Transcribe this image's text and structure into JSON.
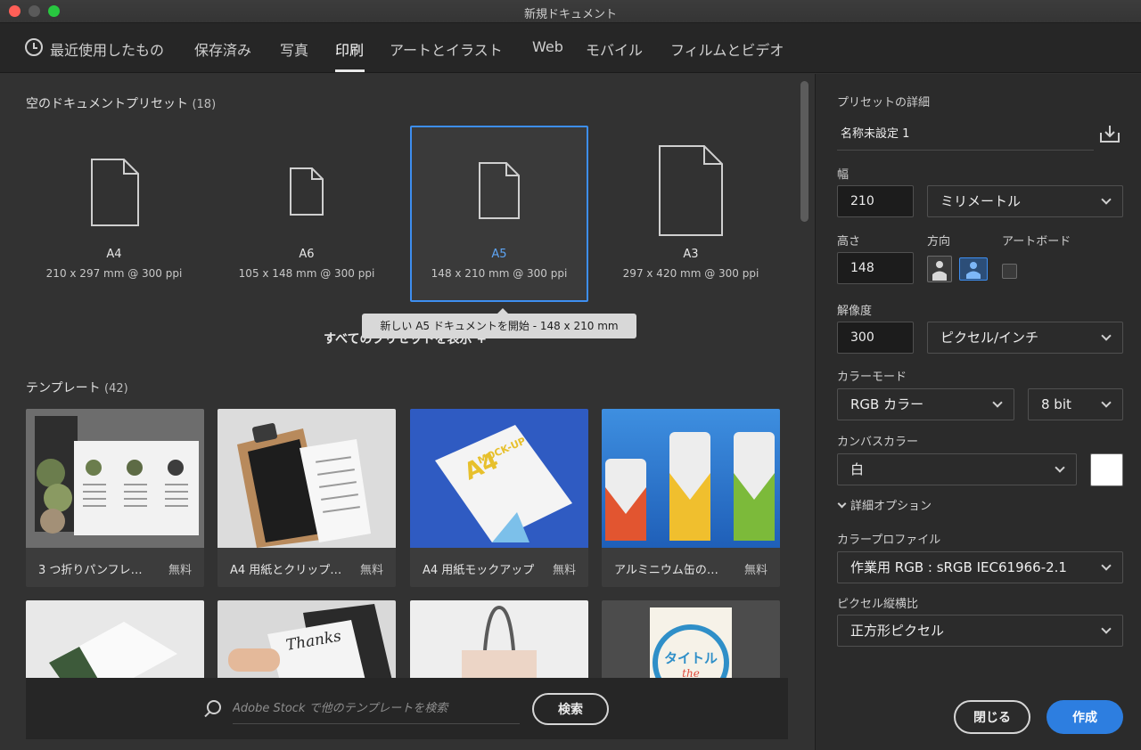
{
  "window": {
    "title": "新規ドキュメント"
  },
  "tabs": [
    {
      "label": "最近使用したもの"
    },
    {
      "label": "保存済み"
    },
    {
      "label": "写真"
    },
    {
      "label": "印刷"
    },
    {
      "label": "アートとイラスト"
    },
    {
      "label": "Web"
    },
    {
      "label": "モバイル"
    },
    {
      "label": "フィルムとビデオ"
    }
  ],
  "presets_section": {
    "title": "空のドキュメントプリセット",
    "count": "(18)"
  },
  "presets": [
    {
      "name": "A4",
      "size": "210 x 297 mm @ 300 ppi"
    },
    {
      "name": "A6",
      "size": "105 x 148 mm @ 300 ppi"
    },
    {
      "name": "A5",
      "size": "148 x 210 mm @ 300 ppi"
    },
    {
      "name": "A3",
      "size": "297 x 420 mm @ 300 ppi"
    }
  ],
  "tooltip": "新しい A5 ドキュメントを開始 - 148 x 210 mm",
  "show_all": "すべてのプリセットを表示 +",
  "templates_section": {
    "title": "テンプレート",
    "count": "(42)"
  },
  "templates": [
    {
      "title": "3 つ折りパンフレ…",
      "price": "無料"
    },
    {
      "title": "A4 用紙とクリップ…",
      "price": "無料"
    },
    {
      "title": "A4 用紙モックアップ",
      "price": "無料"
    },
    {
      "title": "アルミニウム缶の…",
      "price": "無料"
    }
  ],
  "template_art": {
    "mockup": "MOCK-UP",
    "a4": "A4",
    "thanks": "Thanks",
    "title_jp": "タイトル",
    "the": "the"
  },
  "search": {
    "placeholder": "Adobe Stock で他のテンプレートを検索",
    "button": "検索"
  },
  "details": {
    "header": "プリセットの詳細",
    "name": "名称未設定 1",
    "width_label": "幅",
    "width_value": "210",
    "unit": "ミリメートル",
    "height_label": "高さ",
    "height_value": "148",
    "orientation_label": "方向",
    "artboard_label": "アートボード",
    "resolution_label": "解像度",
    "resolution_value": "300",
    "resolution_unit": "ピクセル/インチ",
    "color_mode_label": "カラーモード",
    "color_mode": "RGB カラー",
    "bit_depth": "8 bit",
    "canvas_color_label": "カンバスカラー",
    "canvas_color": "白",
    "advanced": "詳細オプション",
    "profile_label": "カラープロファイル",
    "profile": "作業用 RGB : sRGB IEC61966-2.1",
    "pixel_aspect_label": "ピクセル縦横比",
    "pixel_aspect": "正方形ピクセル"
  },
  "buttons": {
    "close": "閉じる",
    "create": "作成"
  },
  "colors": {
    "accent": "#2d7ee0",
    "selected_border": "#3d8ef0",
    "background": "#323232",
    "panel": "#2b2b2b"
  }
}
